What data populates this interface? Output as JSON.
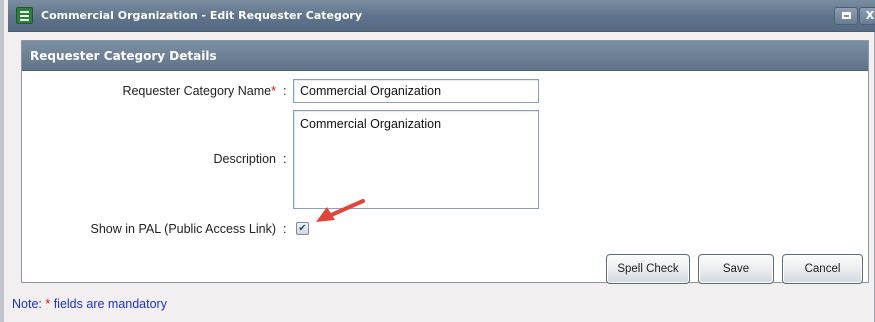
{
  "window": {
    "title": "Commercial Organization - Edit Requester Category",
    "close_label": "X"
  },
  "panel": {
    "title": "Requester Category Details"
  },
  "form": {
    "name_label": "Requester Category Name",
    "required_marker": "*",
    "name_value": "Commercial Organization",
    "description_label": "Description",
    "description_value": "Commercial Organization",
    "pal_label": "Show in PAL (Public Access Link)",
    "pal_checked": true,
    "pal_check_glyph": "✔",
    "colon": ":"
  },
  "buttons": {
    "spell_check": "Spell Check",
    "save": "Save",
    "cancel": "Cancel"
  },
  "note": {
    "prefix": "Note: ",
    "marker": "*",
    "text": " fields are mandatory"
  },
  "colors": {
    "title_bar": "#5e738b",
    "panel_header": "#6c8096",
    "note_text": "#1a34c4",
    "required": "#dd1111",
    "annotation_arrow": "#e0443a"
  },
  "icons": {
    "app": "app-window-icon",
    "maximize": "maximize-icon",
    "close": "close-icon",
    "annotation": "red-arrow-annotation-icon"
  }
}
